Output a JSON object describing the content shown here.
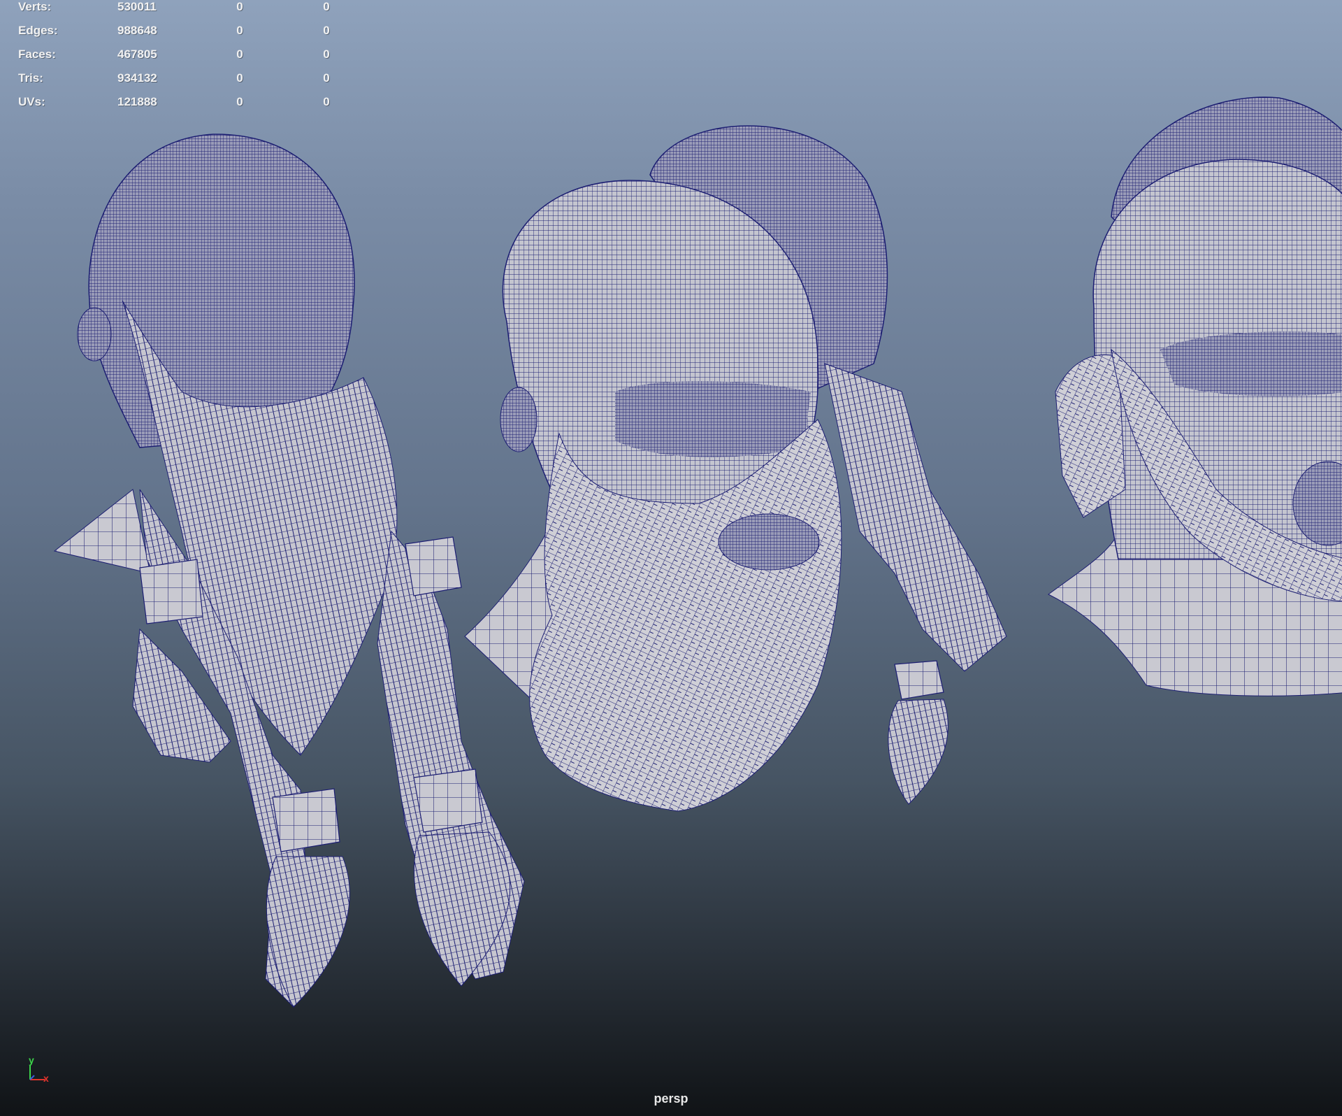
{
  "viewport": {
    "camera": "persp",
    "background_top": "#8fa2bc",
    "background_bottom": "#101316",
    "wire_color": "#1c1e72",
    "surface_color": "#c9c9d1"
  },
  "hud": {
    "rows": [
      {
        "label": "Verts:",
        "total": "530011",
        "selected": "0",
        "component": "0"
      },
      {
        "label": "Edges:",
        "total": "988648",
        "selected": "0",
        "component": "0"
      },
      {
        "label": "Faces:",
        "total": "467805",
        "selected": "0",
        "component": "0"
      },
      {
        "label": "Tris:",
        "total": "934132",
        "selected": "0",
        "component": "0"
      },
      {
        "label": "UVs:",
        "total": "121888",
        "selected": "0",
        "component": "0"
      }
    ]
  },
  "axis": {
    "y_label": "y",
    "x_label": "x",
    "y_color": "#3cd64a",
    "x_color": "#e0342c"
  },
  "icons": [
    "axis-gizmo-icon"
  ]
}
